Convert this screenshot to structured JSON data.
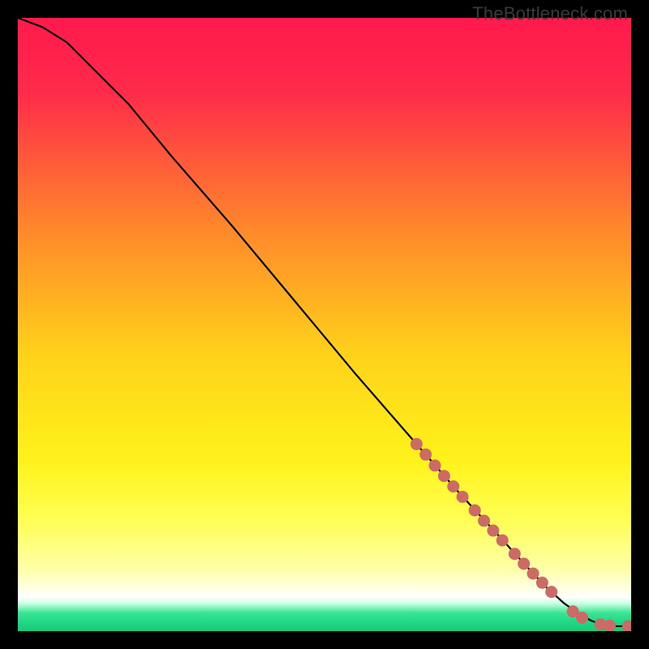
{
  "watermark": "TheBottleneck.com",
  "chart_data": {
    "type": "line",
    "title": "",
    "xlabel": "",
    "ylabel": "",
    "xlim": [
      0,
      100
    ],
    "ylim": [
      0,
      100
    ],
    "gradient_stops": [
      {
        "offset": 0.0,
        "color": "#ff1a4d"
      },
      {
        "offset": 0.12,
        "color": "#ff2a4a"
      },
      {
        "offset": 0.35,
        "color": "#ff8a2a"
      },
      {
        "offset": 0.55,
        "color": "#ffd21a"
      },
      {
        "offset": 0.72,
        "color": "#fff21a"
      },
      {
        "offset": 0.82,
        "color": "#ffff55"
      },
      {
        "offset": 0.9,
        "color": "#ffffaa"
      },
      {
        "offset": 0.945,
        "color": "#ffffff"
      },
      {
        "offset": 0.955,
        "color": "#c8ffe0"
      },
      {
        "offset": 0.97,
        "color": "#3be594"
      },
      {
        "offset": 0.985,
        "color": "#1fd986"
      },
      {
        "offset": 1.0,
        "color": "#19c97a"
      }
    ],
    "curve": {
      "x": [
        0,
        4,
        8,
        12,
        18,
        25,
        35,
        45,
        55,
        65,
        72,
        78,
        83,
        86,
        89,
        91.5,
        93.5,
        95.5,
        97.5,
        100
      ],
      "y": [
        100,
        98.5,
        96,
        92,
        86,
        77.5,
        66,
        54,
        42,
        30.5,
        22.5,
        16,
        10.5,
        7.3,
        4.6,
        2.8,
        1.7,
        1.0,
        0.8,
        0.8
      ]
    },
    "markers": {
      "color": "#cc6a66",
      "points": [
        {
          "x": 65.0,
          "y": 30.5
        },
        {
          "x": 66.5,
          "y": 28.8
        },
        {
          "x": 68.0,
          "y": 27.0
        },
        {
          "x": 69.5,
          "y": 25.3
        },
        {
          "x": 71.0,
          "y": 23.6
        },
        {
          "x": 72.5,
          "y": 21.9
        },
        {
          "x": 74.5,
          "y": 19.7
        },
        {
          "x": 76.0,
          "y": 18.0
        },
        {
          "x": 77.5,
          "y": 16.4
        },
        {
          "x": 79.0,
          "y": 14.8
        },
        {
          "x": 81.0,
          "y": 12.6
        },
        {
          "x": 82.5,
          "y": 11.0
        },
        {
          "x": 84.0,
          "y": 9.4
        },
        {
          "x": 85.5,
          "y": 7.9
        },
        {
          "x": 87.0,
          "y": 6.4
        },
        {
          "x": 90.5,
          "y": 3.2
        },
        {
          "x": 92.0,
          "y": 2.2
        },
        {
          "x": 95.0,
          "y": 1.1
        },
        {
          "x": 96.5,
          "y": 0.9
        },
        {
          "x": 99.5,
          "y": 0.8
        }
      ]
    }
  }
}
